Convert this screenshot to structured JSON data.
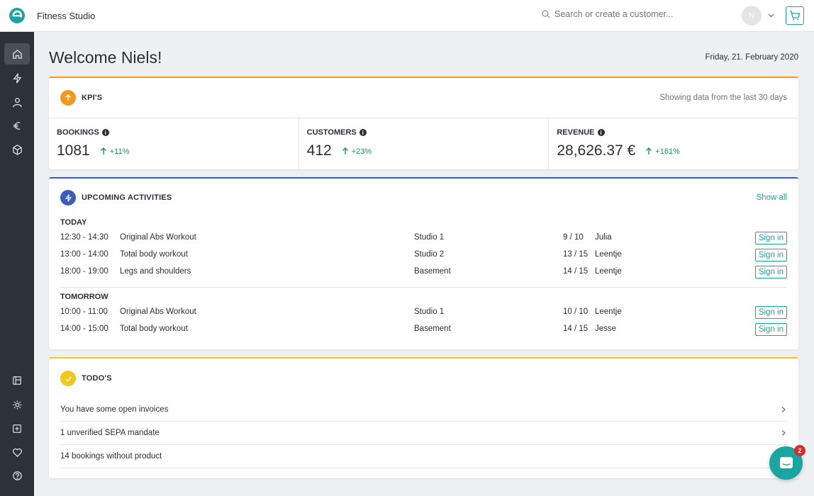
{
  "header": {
    "app_title": "Fitness Studio",
    "search_placeholder": "Search or create a customer...",
    "avatar_initial": "N",
    "accent": "#1aa6a0"
  },
  "sidebar": {
    "items": [
      {
        "icon": "home-icon",
        "active": true
      },
      {
        "icon": "lightning-icon"
      },
      {
        "icon": "user-icon"
      },
      {
        "icon": "euro-icon"
      },
      {
        "icon": "box-icon"
      },
      {
        "icon": "layout-icon"
      },
      {
        "icon": "gear-icon"
      },
      {
        "icon": "plus-square-icon"
      },
      {
        "icon": "heart-icon"
      },
      {
        "icon": "help-icon"
      }
    ]
  },
  "main": {
    "welcome": "Welcome Niels!",
    "date": "Friday, 21. February 2020"
  },
  "kpis": {
    "title": "KPI'S",
    "subtitle": "Showing data from the last 30 days",
    "accent": "#f39a1d",
    "items": [
      {
        "label": "BOOKINGS",
        "value": "1081",
        "trend": "+11%"
      },
      {
        "label": "CUSTOMERS",
        "value": "412",
        "trend": "+23%"
      },
      {
        "label": "REVENUE",
        "value": "28,626.37 €",
        "trend": "+161%"
      }
    ]
  },
  "activities": {
    "title": "UPCOMING ACTIVITIES",
    "show_all": "Show all",
    "accent": "#3b5bbd",
    "sign_in_label": "Sign in",
    "days": [
      {
        "label": "TODAY",
        "rows": [
          {
            "time": "12:30 - 14:30",
            "name": "Original Abs Workout",
            "location": "Studio 1",
            "capacity": "9 / 10",
            "instructor": "Julia"
          },
          {
            "time": "13:00 - 14:00",
            "name": "Total body workout",
            "location": "Studio 2",
            "capacity": "13 / 15",
            "instructor": "Leentje"
          },
          {
            "time": "18:00 - 19:00",
            "name": "Legs and shoulders",
            "location": "Basement",
            "capacity": "14 / 15",
            "instructor": "Leentje"
          }
        ]
      },
      {
        "label": "TOMORROW",
        "rows": [
          {
            "time": "10:00 - 11:00",
            "name": "Original Abs Workout",
            "location": "Studio 1",
            "capacity": "10 / 10",
            "instructor": "Leentje"
          },
          {
            "time": "14:00 - 15:00",
            "name": "Total body workout",
            "location": "Basement",
            "capacity": "14 / 15",
            "instructor": "Jesse"
          }
        ]
      }
    ]
  },
  "todos": {
    "title": "TODO'S",
    "accent": "#f0c91c",
    "items": [
      "You have some open invoices",
      "1 unverified SEPA mandate",
      "14 bookings without product"
    ]
  },
  "chat": {
    "unread_count": "2"
  }
}
